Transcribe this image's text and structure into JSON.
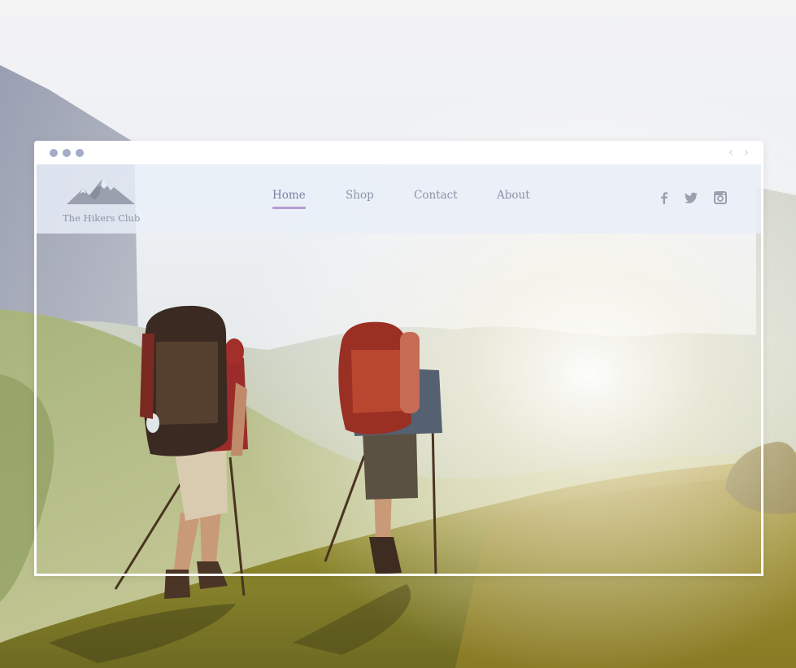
{
  "browser": {
    "window_dots": [
      "dot",
      "dot",
      "dot"
    ],
    "back_icon": "chevron-left-icon",
    "forward_icon": "chevron-right-icon"
  },
  "site": {
    "logo": {
      "name": "The Hikers Club",
      "icon": "mountain-logo-icon"
    },
    "nav": [
      {
        "label": "Home",
        "active": true
      },
      {
        "label": "Shop",
        "active": false
      },
      {
        "label": "Contact",
        "active": false
      },
      {
        "label": "About",
        "active": false
      }
    ],
    "social": [
      "facebook-icon",
      "twitter-icon",
      "instagram-icon"
    ]
  },
  "colors": {
    "header_bg": "#e9eff9",
    "nav_text": "#8b92a7",
    "nav_active_underline": "#b69cd2",
    "window_dot": "#a4acc6"
  }
}
